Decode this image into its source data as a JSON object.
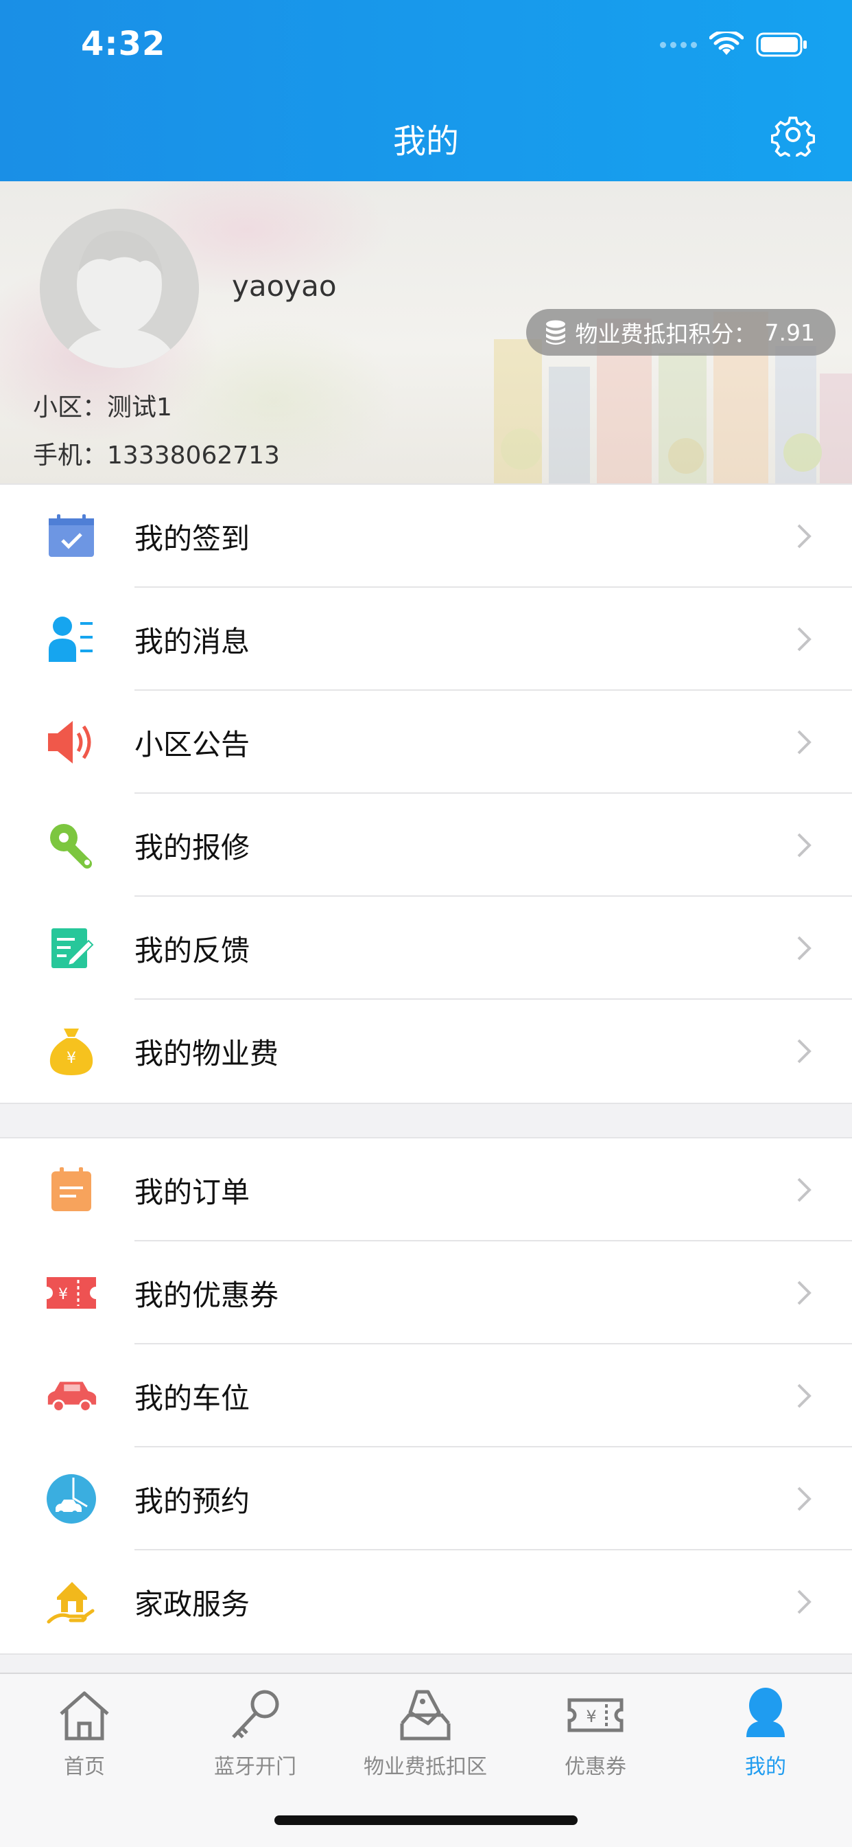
{
  "status_bar": {
    "time": "4:32"
  },
  "header": {
    "title": "我的"
  },
  "profile": {
    "username": "yaoyao",
    "points_label": "物业费抵扣积分：",
    "points_value": "7.91",
    "community_label": "小区：",
    "community_value": "测试1",
    "phone_label": "手机：",
    "phone_value": "13338062713"
  },
  "menu_group_1": [
    {
      "label": "我的签到",
      "icon": "calendar-check-icon",
      "color": "#6d96e3"
    },
    {
      "label": "我的消息",
      "icon": "user-message-icon",
      "color": "#16a5ef"
    },
    {
      "label": "小区公告",
      "icon": "speaker-icon",
      "color": "#f0584a"
    },
    {
      "label": "我的报修",
      "icon": "wrench-icon",
      "color": "#7cc63f"
    },
    {
      "label": "我的反馈",
      "icon": "feedback-note-icon",
      "color": "#27c79a"
    },
    {
      "label": "我的物业费",
      "icon": "money-bag-icon",
      "color": "#f6c21e"
    }
  ],
  "menu_group_2": [
    {
      "label": "我的订单",
      "icon": "order-clipboard-icon",
      "color": "#f7a35c"
    },
    {
      "label": "我的优惠券",
      "icon": "coupon-icon",
      "color": "#ee5252"
    },
    {
      "label": "我的车位",
      "icon": "car-icon",
      "color": "#ee5a5a"
    },
    {
      "label": "我的预约",
      "icon": "car-wash-icon",
      "color": "#3aaee0"
    },
    {
      "label": "家政服务",
      "icon": "home-service-icon",
      "color": "#f2b81c"
    }
  ],
  "tabbar": {
    "tabs": [
      {
        "label": "首页",
        "icon": "home-icon"
      },
      {
        "label": "蓝牙开门",
        "icon": "key-icon"
      },
      {
        "label": "物业费抵扣区",
        "icon": "tag-box-icon"
      },
      {
        "label": "优惠券",
        "icon": "ticket-icon"
      },
      {
        "label": "我的",
        "icon": "person-icon"
      }
    ],
    "active_index": 4,
    "active_color": "#1f9cf0",
    "inactive_color": "#8a8a8a"
  }
}
